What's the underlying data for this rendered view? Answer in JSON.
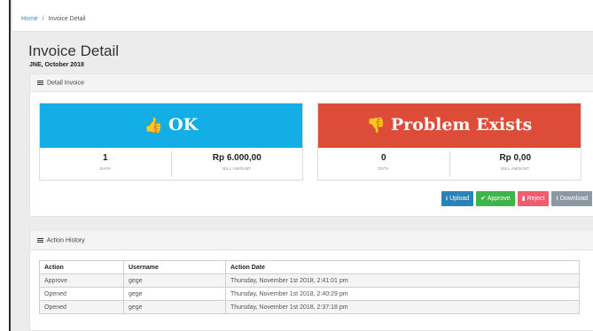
{
  "breadcrumb": {
    "home": "Home",
    "separator": "/",
    "current": "Invoice Detail"
  },
  "page": {
    "title": "Invoice Detail",
    "subtitle": "JNE, October 2018"
  },
  "detail_box": {
    "header": "Detail Invoice",
    "cards": [
      {
        "label": "OK",
        "color": "#13aee6",
        "icon": "thumbs-up-icon",
        "count": "1",
        "count_label": "DATA",
        "amount": "Rp 6.000,00",
        "amount_label": "BILL AMOUNT"
      },
      {
        "label": "Problem Exists",
        "color": "#dd4b39",
        "icon": "thumbs-down-icon",
        "count": "0",
        "count_label": "DATA",
        "amount": "Rp 0,00",
        "amount_label": "BILL AMOUNT"
      }
    ],
    "buttons": {
      "upload": "Upload",
      "approve": "Approve",
      "reject": "Reject",
      "download": "Download"
    }
  },
  "history_box": {
    "header": "Action History",
    "columns": [
      "Action",
      "Username",
      "Action Date"
    ],
    "rows": [
      [
        "Approve",
        "gege",
        "Thursday, November 1st 2018, 2:41:01 pm"
      ],
      [
        "Opened",
        "gege",
        "Thursday, November 1st 2018, 2:40:29 pm"
      ],
      [
        "Opened",
        "gege",
        "Thursday, November 1st 2018, 2:37:18 pm"
      ]
    ]
  }
}
